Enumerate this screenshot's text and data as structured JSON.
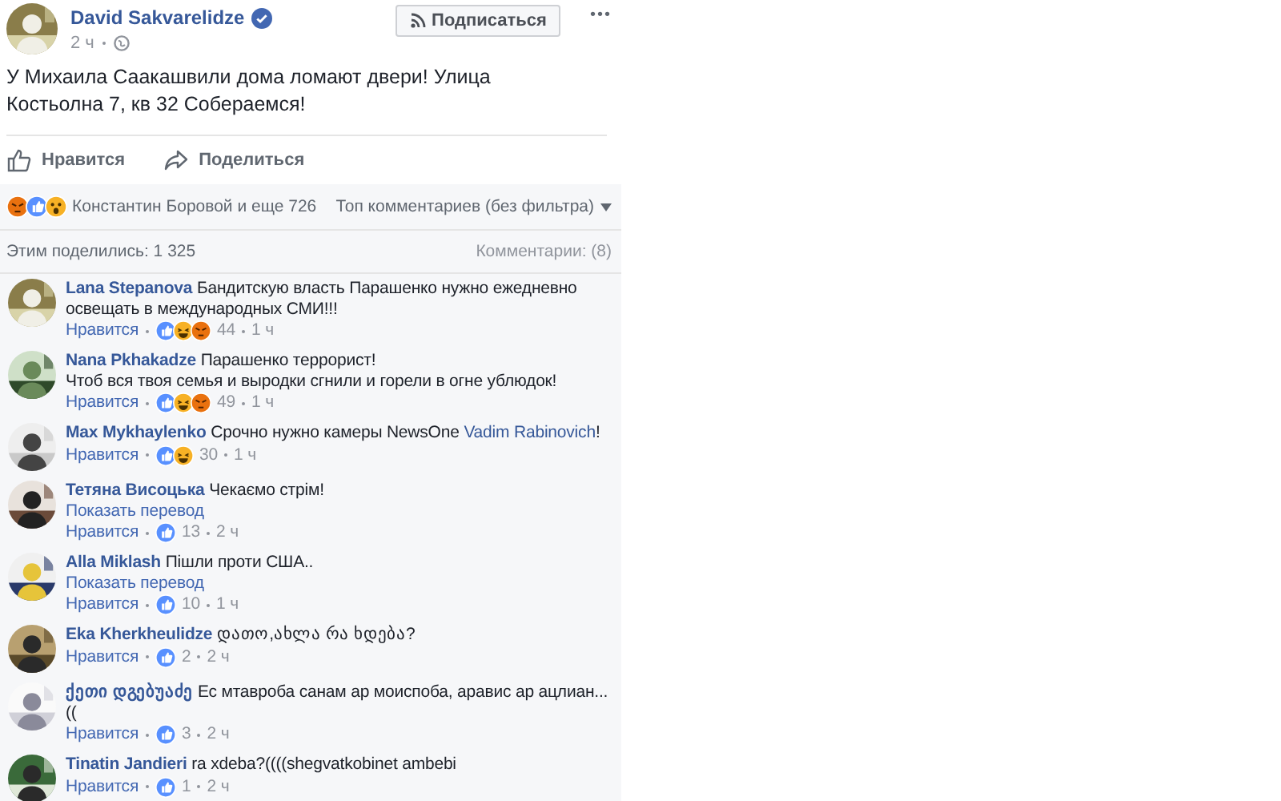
{
  "post": {
    "author": "David Sakvarelidze",
    "verified": true,
    "time": "2 ч",
    "follow_button": "Подписаться",
    "more": "•••",
    "text": "У Михаила Саакашвили дома ломают двери! Улица\nКостьолна 7, кв 32 Собераемся!",
    "actions": [
      {
        "kind": "like",
        "label": "Нравится"
      },
      {
        "kind": "share",
        "label": "Поделиться"
      }
    ]
  },
  "reactions_bar": {
    "reactions": [
      {
        "kind": "angry"
      },
      {
        "kind": "like"
      },
      {
        "kind": "wow"
      }
    ],
    "summary": "Константин Боровой и еще 726",
    "sort": "Топ комментариев (без фильтра)"
  },
  "shares": "Этим поделились: 1 325",
  "comments_count": "Комментарии: (8)",
  "comments": [
    {
      "author": "Lana Stepanova",
      "text": "Бандитскую власть Парашенко нужно ежедневно\nосвещать в международных СМИ!!!",
      "like": "Нравится",
      "reactions": [
        {
          "kind": "like"
        },
        {
          "kind": "haha"
        },
        {
          "kind": "angry"
        }
      ],
      "count": "44",
      "time": "1 ч"
    },
    {
      "author": "Nana Pkhakadze",
      "text": "Парашенко террорист!\nЧтоб вся твоя семья и выродки сгнили и горели в огне ублюдок!",
      "like": "Нравится",
      "reactions": [
        {
          "kind": "like"
        },
        {
          "kind": "haha"
        },
        {
          "kind": "angry"
        }
      ],
      "count": "49",
      "time": "1 ч"
    },
    {
      "author": "Max Mykhaylenko",
      "text": "Срочно нужно камеры NewsOne ",
      "mention": "Vadim Rabinovich",
      "text_after": "!",
      "like": "Нравится",
      "reactions": [
        {
          "kind": "like"
        },
        {
          "kind": "haha"
        }
      ],
      "count": "30",
      "time": "1 ч"
    },
    {
      "author": "Тетяна Висоцька",
      "text": "Чекаємо стрім!",
      "translate": "Показать перевод",
      "like": "Нравится",
      "reactions": [
        {
          "kind": "like"
        }
      ],
      "count": "13",
      "time": "2 ч"
    },
    {
      "author": "Alla Miklash",
      "text": "Пішли проти США..",
      "translate": "Показать перевод",
      "like": "Нравится",
      "reactions": [
        {
          "kind": "like"
        }
      ],
      "count": "10",
      "time": "1 ч"
    },
    {
      "author": "Eka Kherkheulidze",
      "text": "დათო,ახლა რა ხდება?",
      "like": "Нравится",
      "reactions": [
        {
          "kind": "like"
        }
      ],
      "count": "2",
      "time": "2 ч"
    },
    {
      "author": "ქეთი დგებუაძე",
      "text": "Ес мтавроба санам ар моиспоба, аравис ар ацлиан...((",
      "like": "Нравится",
      "reactions": [
        {
          "kind": "like"
        }
      ],
      "count": "3",
      "time": "2 ч"
    },
    {
      "author": "Tinatin Jandieri",
      "text": "ra xdeba?((((shegvatkobinet ambebi",
      "like": "Нравится",
      "reactions": [
        {
          "kind": "like"
        }
      ],
      "count": "1",
      "time": "2 ч"
    }
  ]
}
